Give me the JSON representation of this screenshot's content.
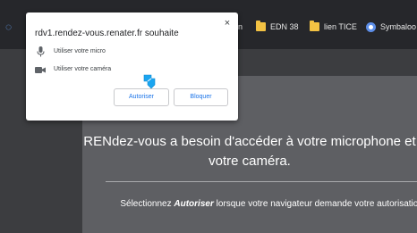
{
  "bookmarks_bar": {
    "partial_item_text": "n",
    "items": [
      {
        "label": "EDN 38",
        "icon": "folder-icon"
      },
      {
        "label": "lien TICE",
        "icon": "folder-icon"
      },
      {
        "label": "Symbaloo",
        "icon": "symbaloo-icon"
      }
    ]
  },
  "permission_popup": {
    "title": "rdv1.rendez-vous.renater.fr souhaite",
    "close_glyph": "×",
    "permissions": [
      {
        "label": "Utiliser votre micro",
        "icon": "microphone-icon"
      },
      {
        "label": "Utiliser votre caméra",
        "icon": "video-camera-icon"
      }
    ],
    "allow_label": "Autoriser",
    "block_label": "Bloquer"
  },
  "page": {
    "heading": "RENdez-vous a besoin d'accéder à votre microphone et votre caméra.",
    "instruction_prefix": "Sélectionnez ",
    "instruction_emphasis": "Autoriser",
    "instruction_suffix": " lorsque votre navigateur demande votre autorisation."
  },
  "colors": {
    "accent": "#1a73e8",
    "annotation_arrow": "#1ba5f0",
    "panel": "#5e5f63",
    "background": "#3c3d40"
  }
}
